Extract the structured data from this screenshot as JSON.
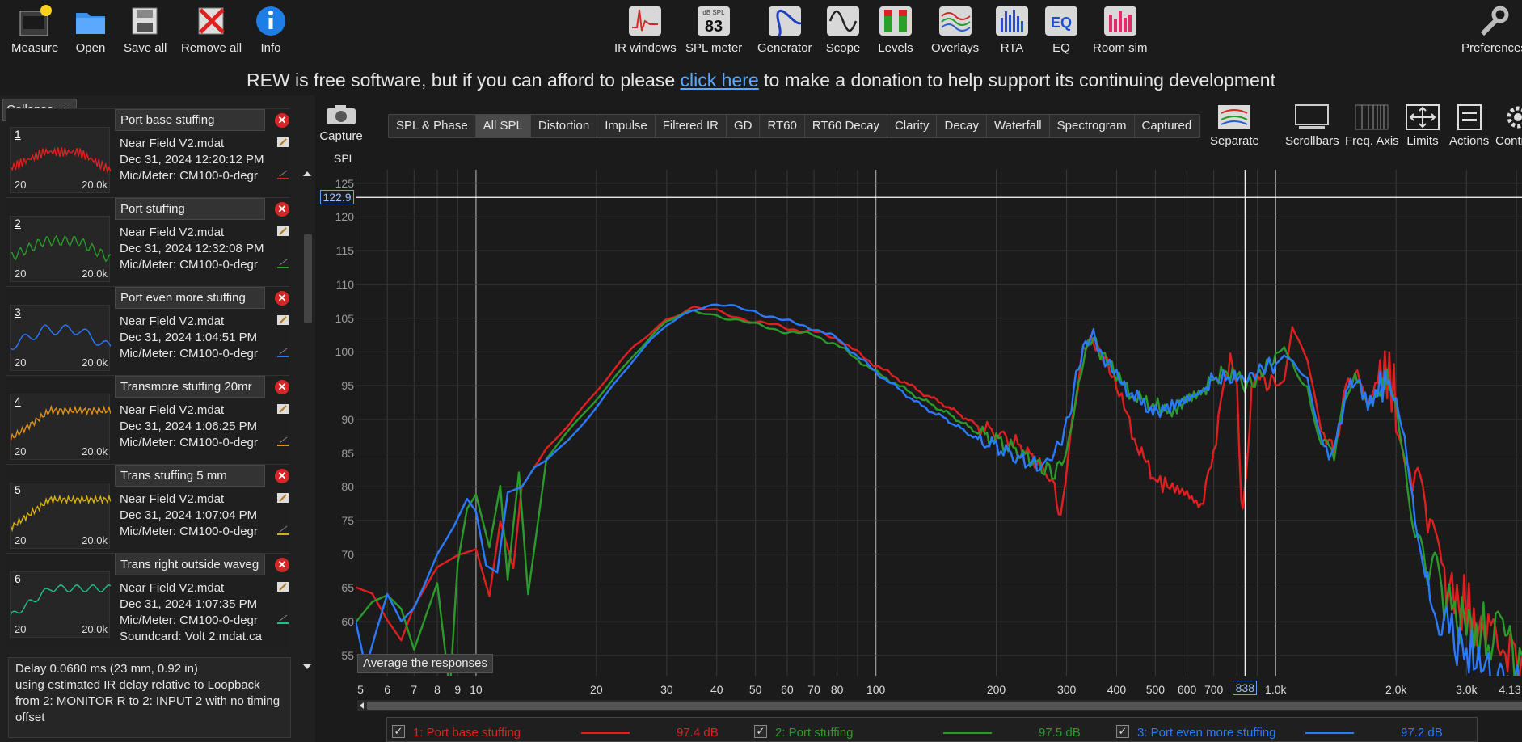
{
  "toolbar": {
    "left": [
      {
        "label": "Measure",
        "x": 14
      },
      {
        "label": "Open",
        "x": 90
      },
      {
        "label": "Save all",
        "x": 153
      },
      {
        "label": "Remove all",
        "x": 224
      },
      {
        "label": "Info",
        "x": 313
      }
    ],
    "center": [
      {
        "label": "IR windows",
        "x": 760
      },
      {
        "label": "SPL meter",
        "x": 848
      },
      {
        "label": "Generator",
        "x": 937
      },
      {
        "label": "Scope",
        "x": 1021
      },
      {
        "label": "Levels",
        "x": 1086
      },
      {
        "label": "Overlays",
        "x": 1152
      },
      {
        "label": "RTA",
        "x": 1230
      },
      {
        "label": "EQ",
        "x": 1291
      },
      {
        "label": "Room sim",
        "x": 1352
      }
    ],
    "spl_meter_value": "83",
    "spl_meter_unit": "dB SPL",
    "eq_icon_text": "EQ",
    "preferences_label": "Preferences"
  },
  "banner": {
    "before": "REW is free software, but if you can afford to please ",
    "link": "click here",
    "after": " to make a donation to help support its continuing development"
  },
  "sidebar": {
    "collapse_label": "Collapse",
    "measurements": [
      {
        "num": "1",
        "name": "Port base stuffing",
        "file": "Near Field V2.mdat",
        "date": "Dec 31, 2024 12:20:12 PM",
        "mic": "Mic/Meter: CM100-0-degr",
        "color": "#e02020"
      },
      {
        "num": "2",
        "name": "Port stuffing",
        "file": "Near Field V2.mdat",
        "date": "Dec 31, 2024 12:32:08 PM",
        "mic": "Mic/Meter: CM100-0-degr",
        "color": "#2a9a2a"
      },
      {
        "num": "3",
        "name": "Port even more stuffing",
        "file": "Near Field V2.mdat",
        "date": "Dec 31, 2024 1:04:51 PM",
        "mic": "Mic/Meter: CM100-0-degr",
        "color": "#2a7aff"
      },
      {
        "num": "4",
        "name": "Transmore stuffing 20mr",
        "file": "Near Field V2.mdat",
        "date": "Dec 31, 2024 1:06:25 PM",
        "mic": "Mic/Meter: CM100-0-degr",
        "color": "#e0901a"
      },
      {
        "num": "5",
        "name": "Trans stuffing 5 mm",
        "file": "Near Field V2.mdat",
        "date": "Dec 31, 2024 1:07:04 PM",
        "mic": "Mic/Meter: CM100-0-degr",
        "color": "#d8b010"
      },
      {
        "num": "6",
        "name": "Trans right outside waveg",
        "file": "Near Field V2.mdat",
        "date": "Dec 31, 2024 1:07:35 PM",
        "mic": "Mic/Meter: CM100-0-degr",
        "color": "#20c08a"
      }
    ],
    "thumb_lo": "20",
    "thumb_hi": "20.0k",
    "soundcard": "Soundcard: Volt 2.mdat.ca",
    "delay_lines": [
      "Delay 0.0680 ms (23 mm, 0.92 in)",
      "using estimated IR delay relative to Loopback",
      "from 2: MONITOR R to 2: INPUT 2 with no timing",
      "offset"
    ]
  },
  "graph_header": {
    "capture_label": "Capture",
    "spl_label": "SPL",
    "tabs": [
      "SPL & Phase",
      "All SPL",
      "Distortion",
      "Impulse",
      "Filtered IR",
      "GD",
      "RT60",
      "RT60 Decay",
      "Clarity",
      "Decay",
      "Waterfall",
      "Spectrogram",
      "Captured"
    ],
    "active_tab": "All SPL",
    "right_tools": [
      {
        "label": "Separate",
        "x": 1497
      },
      {
        "label": "Scrollbars",
        "x": 1590
      },
      {
        "label": "Freq. Axis",
        "x": 1664
      },
      {
        "label": "Limits",
        "x": 1738
      },
      {
        "label": "Actions",
        "x": 1793
      },
      {
        "label": "Controls",
        "x": 1850
      }
    ]
  },
  "chart_data": {
    "type": "line",
    "ylabel": "SPL",
    "ylim": [
      52,
      127
    ],
    "y_ticks": [
      125,
      120,
      115,
      110,
      105,
      100,
      95,
      90,
      85,
      80,
      75,
      70,
      65,
      60,
      55
    ],
    "x_scale": "log",
    "xlim": [
      5,
      4130
    ],
    "x_tick_labels": [
      {
        "v": 5,
        "t": "5"
      },
      {
        "v": 6,
        "t": "6"
      },
      {
        "v": 7,
        "t": "7"
      },
      {
        "v": 8,
        "t": "8"
      },
      {
        "v": 9,
        "t": "9"
      },
      {
        "v": 10,
        "t": "10"
      },
      {
        "v": 20,
        "t": "20"
      },
      {
        "v": 30,
        "t": "30"
      },
      {
        "v": 40,
        "t": "40"
      },
      {
        "v": 50,
        "t": "50"
      },
      {
        "v": 60,
        "t": "60"
      },
      {
        "v": 70,
        "t": "70"
      },
      {
        "v": 80,
        "t": "80"
      },
      {
        "v": 100,
        "t": "100"
      },
      {
        "v": 200,
        "t": "200"
      },
      {
        "v": 300,
        "t": "300"
      },
      {
        "v": 400,
        "t": "400"
      },
      {
        "v": 500,
        "t": "500"
      },
      {
        "v": 600,
        "t": "600"
      },
      {
        "v": 700,
        "t": "700"
      },
      {
        "v": 800,
        "t": "8"
      },
      {
        "v": 1000,
        "t": "1.0k"
      },
      {
        "v": 2000,
        "t": "2.0k"
      },
      {
        "v": 3000,
        "t": "3.0k"
      },
      {
        "v": 4130,
        "t": "4.13"
      }
    ],
    "cursor_y": "122.9",
    "cursor_x": "838",
    "cursor_x_value": 838,
    "cursor_y_value": 122.9,
    "series": [
      {
        "name": "1: Port base stuffing",
        "color": "#e02020",
        "level": "97.4 dB",
        "x": [
          5,
          5.5,
          6,
          6.5,
          7,
          8,
          9,
          10,
          10.8,
          11.5,
          12.4,
          13,
          15,
          17,
          20,
          25,
          30,
          35,
          40,
          50,
          60,
          70,
          80,
          100,
          130,
          150,
          180,
          200,
          230,
          260,
          280,
          290,
          310,
          330,
          350,
          400,
          450,
          500,
          600,
          650,
          700,
          740,
          770,
          800,
          820,
          840,
          870,
          900,
          950,
          1000,
          1050,
          1100,
          1200,
          1300,
          1400,
          1500,
          1600,
          1700,
          1800,
          1900,
          2000,
          2100,
          2200,
          2400,
          2600,
          2800,
          3000,
          3500,
          4130
        ],
        "y": [
          65,
          64,
          60,
          57,
          62,
          68,
          70,
          71,
          64,
          75,
          68,
          80,
          86,
          89,
          94,
          101,
          105,
          106.5,
          106,
          104.5,
          103.5,
          103,
          102,
          98,
          94,
          92,
          89,
          88,
          86,
          83,
          80,
          75,
          90,
          100,
          102,
          95,
          86,
          81,
          79,
          77,
          85,
          95,
          99,
          95,
          77,
          80,
          94,
          97,
          95,
          96,
          97,
          105,
          100,
          89,
          85,
          95,
          97,
          92,
          96,
          97,
          93,
          88,
          82,
          72,
          68,
          64,
          62,
          58,
          55
        ]
      },
      {
        "name": "2: Port stuffing",
        "color": "#2a9a2a",
        "level": "97.5 dB",
        "x": [
          5,
          5.5,
          6,
          6.5,
          7,
          8,
          8.6,
          9,
          9.5,
          10,
          10.8,
          11.5,
          12,
          12.8,
          13.5,
          15,
          17,
          20,
          25,
          30,
          35,
          40,
          50,
          60,
          70,
          80,
          100,
          130,
          150,
          180,
          200,
          230,
          260,
          280,
          300,
          330,
          350,
          400,
          450,
          500,
          550,
          600,
          650,
          700,
          750,
          800,
          850,
          900,
          950,
          1000,
          1050,
          1100,
          1200,
          1300,
          1400,
          1500,
          1600,
          1700,
          1800,
          1900,
          2000,
          2100,
          2200,
          2400,
          2600,
          2800,
          3000,
          3500,
          4130
        ],
        "y": [
          60,
          63,
          64,
          62,
          56,
          66,
          50,
          69,
          77,
          79,
          71,
          80,
          66,
          82,
          64,
          84,
          88,
          93,
          100,
          104.5,
          106,
          105.5,
          104,
          103,
          102.5,
          101,
          97,
          93,
          91,
          88,
          87,
          85,
          83,
          82,
          85,
          99,
          102,
          96,
          93,
          92,
          91,
          93,
          94,
          96,
          97,
          96,
          95,
          96,
          98,
          99,
          100,
          98,
          95,
          87,
          85,
          94,
          96,
          92,
          94,
          96,
          92,
          86,
          78,
          70,
          66,
          62,
          60,
          57,
          55
        ]
      },
      {
        "name": "3: Port even more stuffing",
        "color": "#2a7aff",
        "level": "97.2 dB",
        "x": [
          5,
          5.3,
          5.6,
          6,
          6.5,
          7,
          7.5,
          8,
          8.8,
          9.5,
          10,
          10.6,
          11.3,
          12,
          13,
          14,
          15,
          17,
          20,
          25,
          30,
          35,
          40,
          45,
          50,
          60,
          70,
          80,
          100,
          130,
          150,
          180,
          200,
          230,
          260,
          280,
          300,
          330,
          350,
          400,
          450,
          500,
          550,
          600,
          650,
          700,
          750,
          800,
          850,
          900,
          950,
          1000,
          1050,
          1100,
          1200,
          1300,
          1400,
          1500,
          1600,
          1700,
          1800,
          1900,
          2000,
          2100,
          2200,
          2400,
          2600,
          2800,
          3000,
          3500,
          4130
        ],
        "y": [
          60,
          53,
          58,
          64,
          60,
          62,
          66,
          70,
          74,
          78,
          76,
          68,
          67,
          79,
          80,
          83,
          84,
          87,
          92,
          99,
          104,
          106.5,
          107,
          106.5,
          106,
          104.5,
          103.5,
          102,
          97,
          92,
          90,
          87,
          86,
          84,
          83,
          85,
          89,
          101,
          102,
          96,
          93,
          91,
          92,
          93,
          94,
          96,
          96,
          96,
          96,
          97,
          98,
          98,
          99,
          98,
          95,
          86,
          85,
          94,
          96,
          92,
          94,
          96,
          92,
          85,
          76,
          68,
          62,
          58,
          55,
          52,
          52
        ]
      }
    ]
  }
}
